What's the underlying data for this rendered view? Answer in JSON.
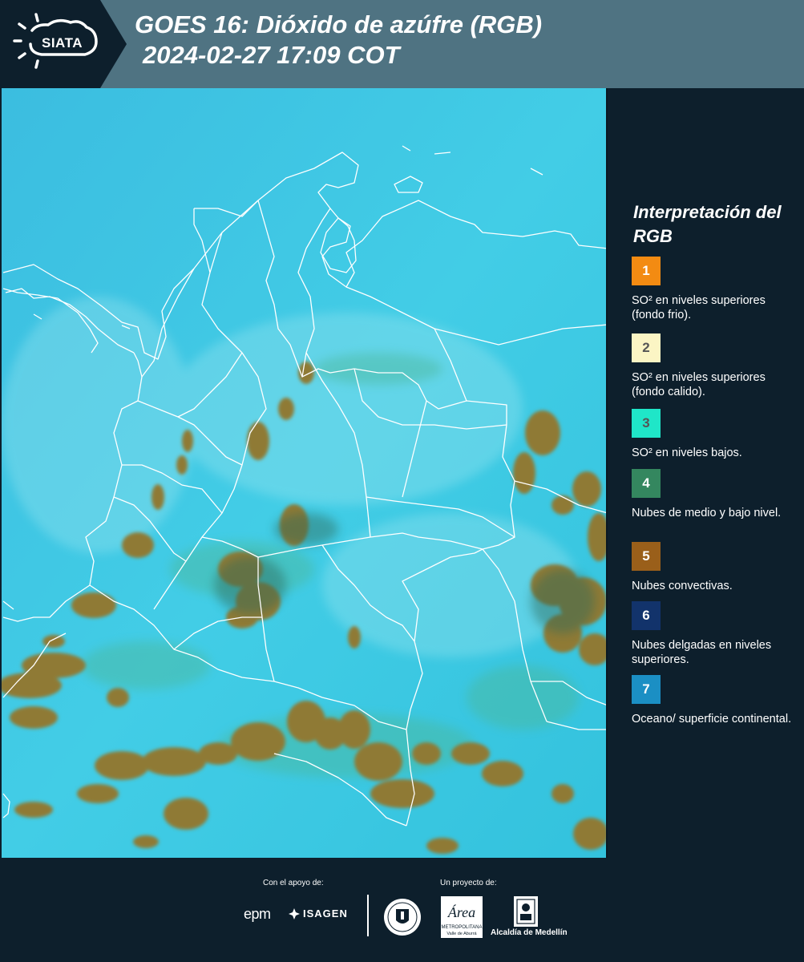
{
  "header": {
    "logo_text": "SIATA",
    "title_line1": "GOES 16: Dióxido de azúfre (RGB)",
    "title_line2": "2024-02-27 17:09 COT",
    "bg_color": "#4f7382"
  },
  "legend": {
    "title": "Interpretación del RGB",
    "items": [
      {
        "number": "1",
        "color": "#f38b12",
        "label": "SO² en niveles superiores (fondo frio)."
      },
      {
        "number": "2",
        "color": "#fbf5c4",
        "label": "SO² en niveles superiores (fondo calido)."
      },
      {
        "number": "3",
        "color": "#1fe6c8",
        "label": "SO² en niveles bajos."
      },
      {
        "number": "4",
        "color": "#34875f",
        "label": "Nubes de medio y bajo nivel."
      },
      {
        "number": "5",
        "color": "#9a5f1a",
        "label": "Nubes convectivas."
      },
      {
        "number": "6",
        "color": "#12336b",
        "label": "Nubes delgadas en niveles superiores."
      },
      {
        "number": "7",
        "color": "#1b8fc4",
        "label": "Oceano/ superficie continental."
      }
    ]
  },
  "footer": {
    "support_label": "Con el apoyo de:",
    "project_label": "Un proyecto de:",
    "epm": "epm",
    "isagen": "ISAGEN",
    "area": "Área",
    "area_sub1": "METROPOLITANA",
    "area_sub2": "Valle de Aburrá",
    "alcaldia": "Alcaldía de Medellín"
  },
  "map": {
    "background_color": "#3cc7e0",
    "cloud_color": "#8f7a36",
    "border_color": "#ffffff"
  }
}
